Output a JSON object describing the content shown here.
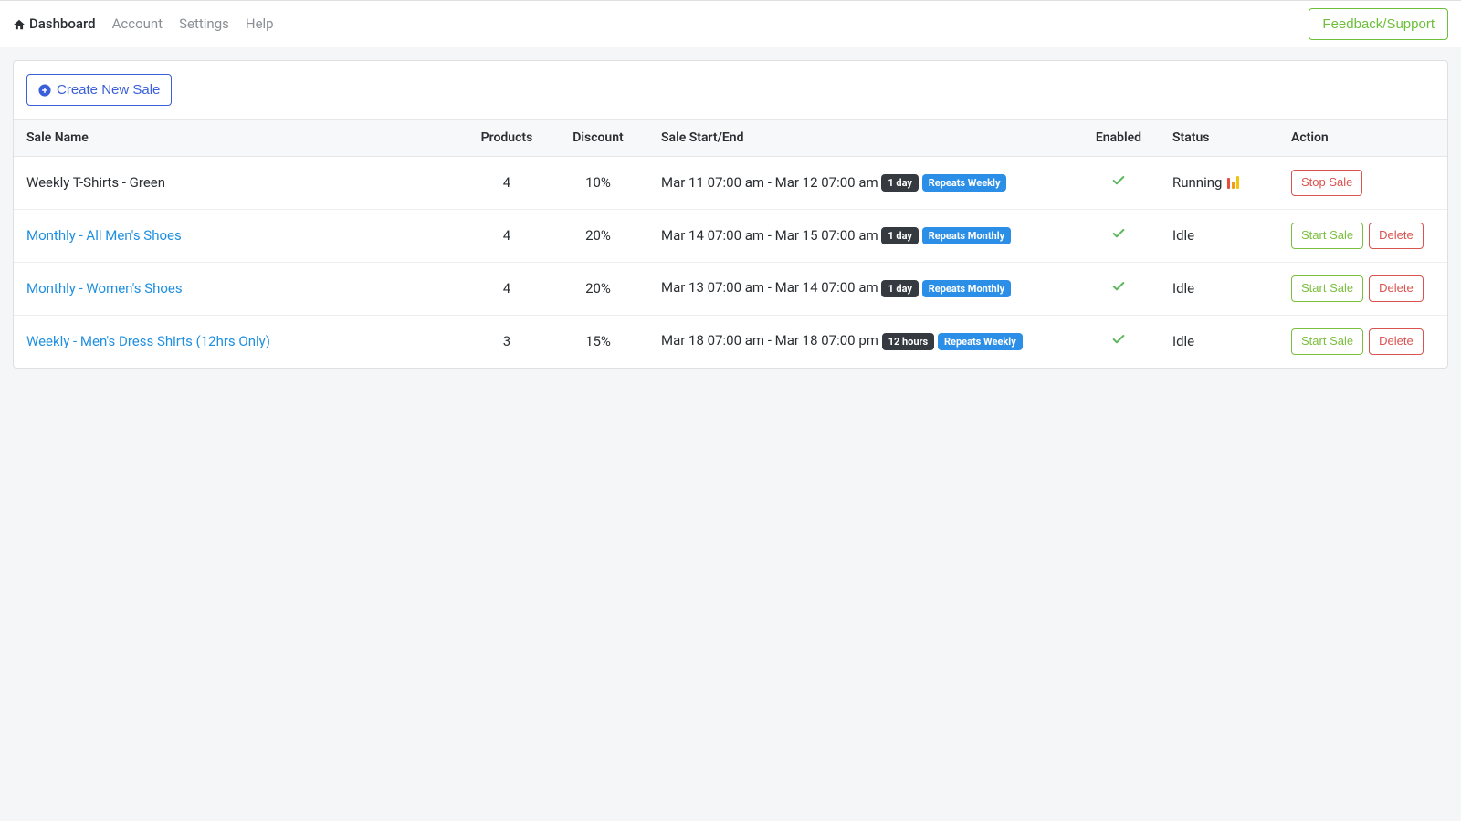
{
  "nav": {
    "dashboard": "Dashboard",
    "account": "Account",
    "settings": "Settings",
    "help": "Help",
    "feedback": "Feedback/Support"
  },
  "panel": {
    "create_button": "Create New Sale"
  },
  "table": {
    "headers": {
      "sale_name": "Sale Name",
      "products": "Products",
      "discount": "Discount",
      "start_end": "Sale Start/End",
      "enabled": "Enabled",
      "status": "Status",
      "action": "Action"
    },
    "rows": [
      {
        "name": "Weekly T-Shirts - Green",
        "name_is_link": false,
        "products": "4",
        "discount": "10%",
        "timerange": "Mar 11 07:00 am - Mar 12 07:00 am",
        "duration_badge": "1 day",
        "repeat_badge": "Repeats Weekly",
        "enabled": true,
        "status": "Running",
        "status_running": true,
        "actions": [
          {
            "label": "Stop Sale",
            "style": "red"
          }
        ]
      },
      {
        "name": "Monthly - All Men's Shoes",
        "name_is_link": true,
        "products": "4",
        "discount": "20%",
        "timerange": "Mar 14 07:00 am - Mar 15 07:00 am",
        "duration_badge": "1 day",
        "repeat_badge": "Repeats Monthly",
        "enabled": true,
        "status": "Idle",
        "status_running": false,
        "actions": [
          {
            "label": "Start Sale",
            "style": "green"
          },
          {
            "label": "Delete",
            "style": "red"
          }
        ]
      },
      {
        "name": "Monthly - Women's Shoes",
        "name_is_link": true,
        "products": "4",
        "discount": "20%",
        "timerange": "Mar 13 07:00 am - Mar 14 07:00 am",
        "duration_badge": "1 day",
        "repeat_badge": "Repeats Monthly",
        "enabled": true,
        "status": "Idle",
        "status_running": false,
        "actions": [
          {
            "label": "Start Sale",
            "style": "green"
          },
          {
            "label": "Delete",
            "style": "red"
          }
        ]
      },
      {
        "name": "Weekly - Men's Dress Shirts (12hrs Only)",
        "name_is_link": true,
        "products": "3",
        "discount": "15%",
        "timerange": "Mar 18 07:00 am - Mar 18 07:00 pm",
        "duration_badge": "12 hours",
        "repeat_badge": "Repeats Weekly",
        "enabled": true,
        "status": "Idle",
        "status_running": false,
        "actions": [
          {
            "label": "Start Sale",
            "style": "green"
          },
          {
            "label": "Delete",
            "style": "red"
          }
        ]
      }
    ]
  }
}
